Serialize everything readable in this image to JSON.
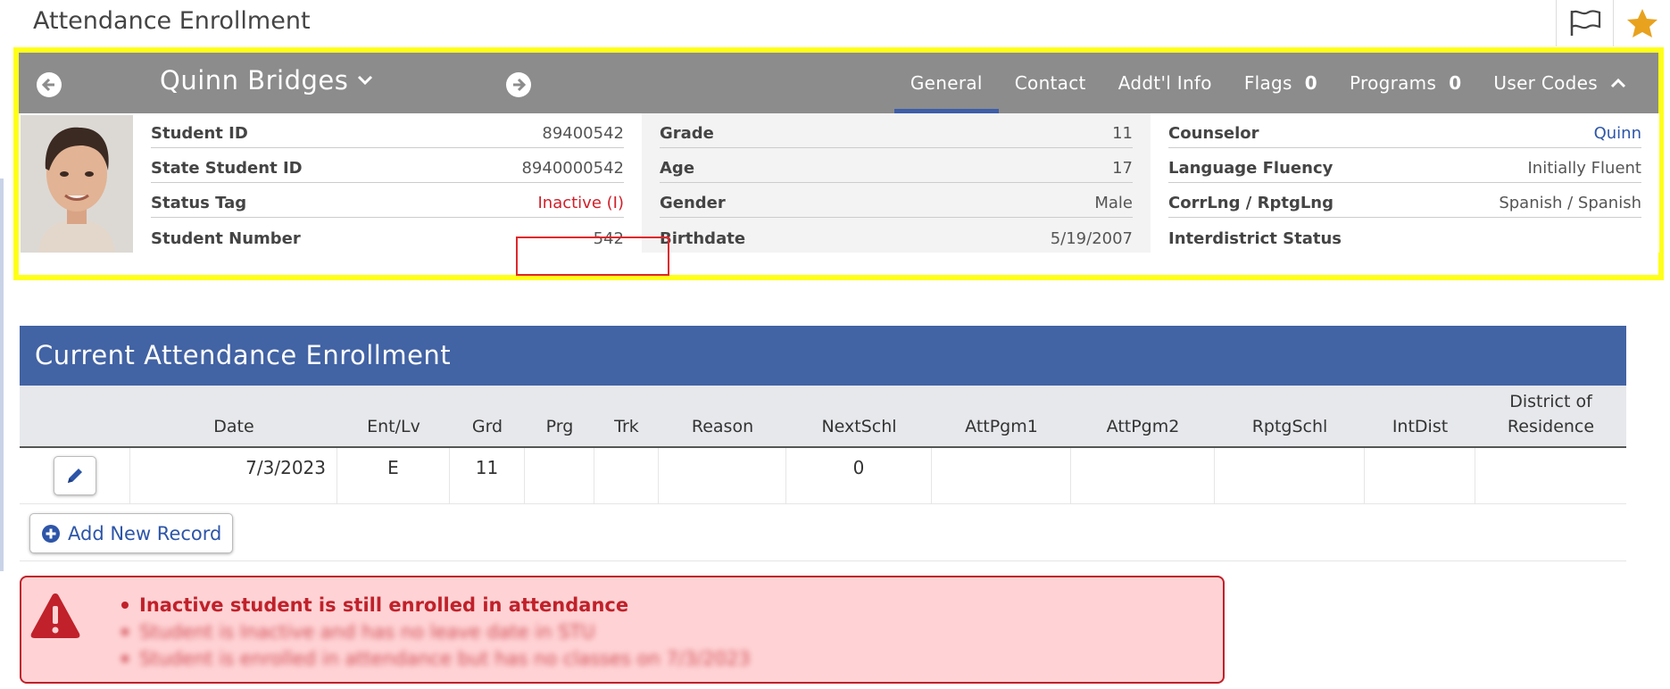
{
  "page": {
    "title": "Attendance Enrollment"
  },
  "title_actions": [
    {
      "icon": "flag-icon",
      "label": ""
    },
    {
      "icon": "star-icon",
      "label": "",
      "color": "#e8a21e"
    }
  ],
  "student": {
    "name": "Quinn Bridges",
    "tabs": [
      {
        "label": "General",
        "count": "",
        "active": true
      },
      {
        "label": "Contact",
        "count": ""
      },
      {
        "label": "Addt'l Info",
        "count": ""
      },
      {
        "label": "Flags",
        "count": "0"
      },
      {
        "label": "Programs",
        "count": "0"
      },
      {
        "label": "User Codes",
        "count": ""
      }
    ],
    "col1": [
      {
        "label": "Student ID",
        "value": "89400542"
      },
      {
        "label": "State Student ID",
        "value": "8940000542"
      },
      {
        "label": "Status Tag",
        "value": "Inactive (I)"
      },
      {
        "label": "Student Number",
        "value": "542"
      }
    ],
    "col2": [
      {
        "label": "Grade",
        "value": "11"
      },
      {
        "label": "Age",
        "value": "17"
      },
      {
        "label": "Gender",
        "value": "Male"
      },
      {
        "label": "Birthdate",
        "value": "5/19/2007"
      }
    ],
    "col3": [
      {
        "label": "Counselor",
        "value": "Quinn"
      },
      {
        "label": "Language Fluency",
        "value": "Initially Fluent"
      },
      {
        "label": "CorrLng / RptgLng",
        "value": "Spanish / Spanish"
      },
      {
        "label": "Interdistrict Status",
        "value": ""
      }
    ]
  },
  "enrollment": {
    "title": "Current Attendance Enrollment",
    "columns": [
      "",
      "Date",
      "Ent/Lv",
      "Grd",
      "Prg",
      "Trk",
      "Reason",
      "NextSchl",
      "AttPgm1",
      "AttPgm2",
      "RptgSchl",
      "IntDist",
      "District of Residence"
    ],
    "rows": [
      [
        "",
        "7/3/2023",
        "E",
        "11",
        "",
        "",
        "",
        "0",
        "",
        "",
        "",
        "",
        ""
      ]
    ],
    "add_label": "Add New Record"
  },
  "errors": [
    "Inactive student is still enrolled in attendance",
    "Student is Inactive and has no leave date in STU",
    "Student is enrolled in attendance but has no classes on 7/3/2023"
  ],
  "colors": {
    "highlight": "#ffff1a",
    "header_bar": "#8c8c8c",
    "panel_blue": "#4263a4",
    "error_red": "#c0212a",
    "error_bg": "#ffd3d5"
  }
}
